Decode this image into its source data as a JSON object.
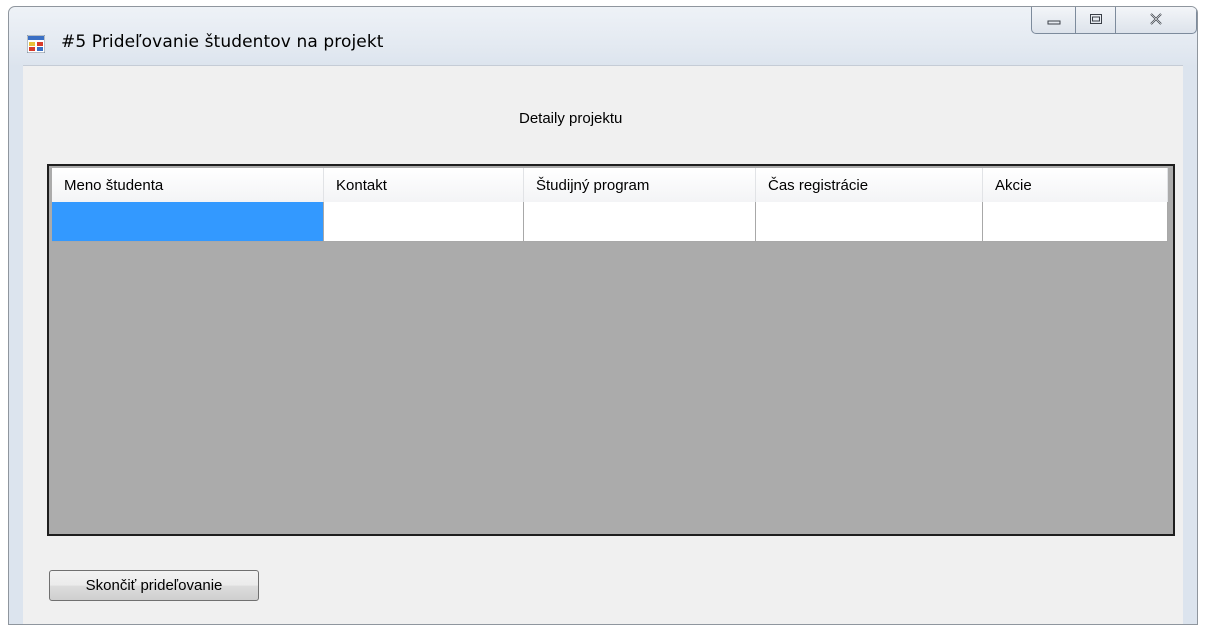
{
  "window": {
    "title": "#5 Prideľovanie študentov na projekt",
    "icon": "winforms-app-icon",
    "caption_buttons": [
      "minimize-icon",
      "restore-icon",
      "close-icon"
    ]
  },
  "main": {
    "caption": "Detaily projektu",
    "grid": {
      "columns": [
        "Meno študenta",
        "Kontakt",
        "Študijný program",
        "Čas registrácie",
        "Akcie"
      ],
      "rows": [
        [
          "",
          "",
          "",
          "",
          ""
        ]
      ],
      "selected_cell": {
        "row": 0,
        "column": 0
      }
    },
    "finish_button_label": "Skončiť prideľovanie"
  },
  "colors": {
    "selection": "#3399ff",
    "grid_background": "#ababab",
    "client_background": "#f0f0f0"
  }
}
